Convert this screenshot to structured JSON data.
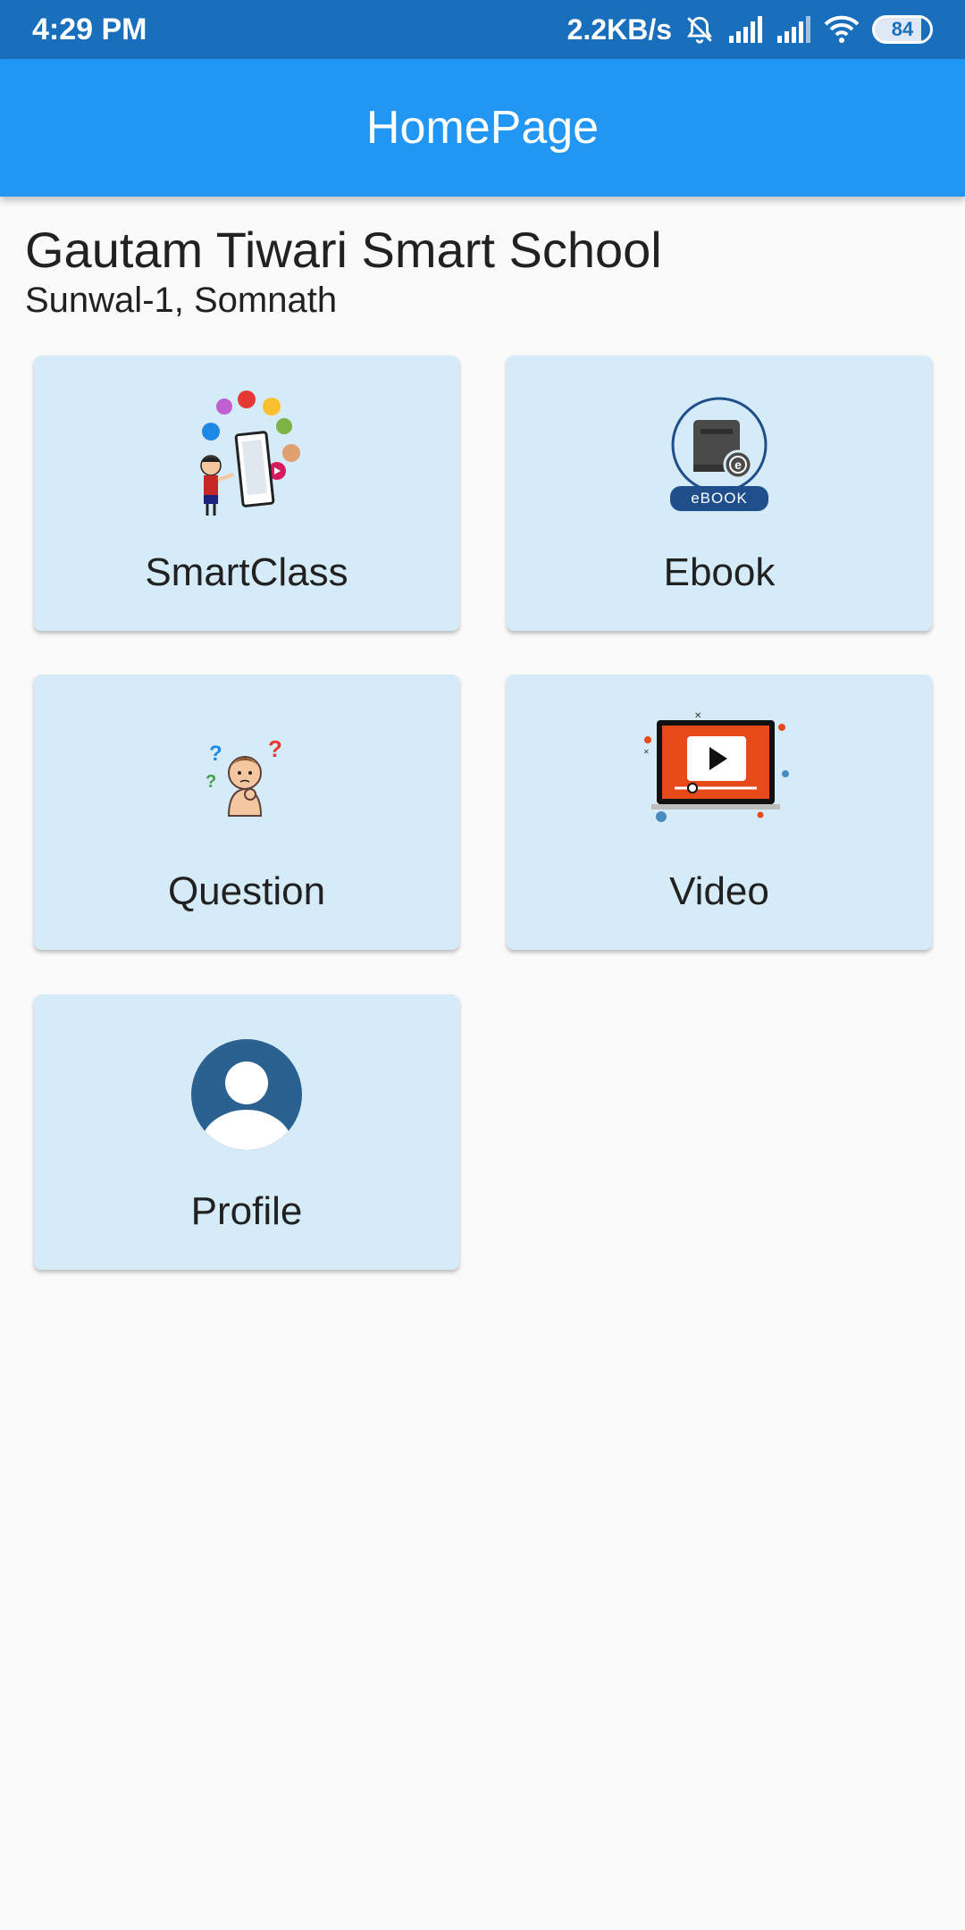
{
  "status_bar": {
    "time": "4:29 PM",
    "net_speed": "2.2KB/s",
    "battery": "84",
    "icons": [
      "mute-bell-icon",
      "signal-icon",
      "signal-icon",
      "wifi-icon",
      "battery-icon"
    ]
  },
  "app_bar": {
    "title": "HomePage"
  },
  "school": {
    "name": "Gautam Tiwari Smart School",
    "address": "Sunwal-1, Somnath"
  },
  "menu": [
    {
      "label": "SmartClass",
      "icon": "smartclass-icon"
    },
    {
      "label": "Ebook",
      "icon": "ebook-icon",
      "badge": "eBOOK"
    },
    {
      "label": "Question",
      "icon": "question-icon"
    },
    {
      "label": "Video",
      "icon": "video-icon"
    },
    {
      "label": "Profile",
      "icon": "profile-icon"
    }
  ],
  "colors": {
    "status_bar": "#1a6fbd",
    "app_bar": "#2196f3",
    "card": "#d6ebf8",
    "background": "#fafafa"
  }
}
